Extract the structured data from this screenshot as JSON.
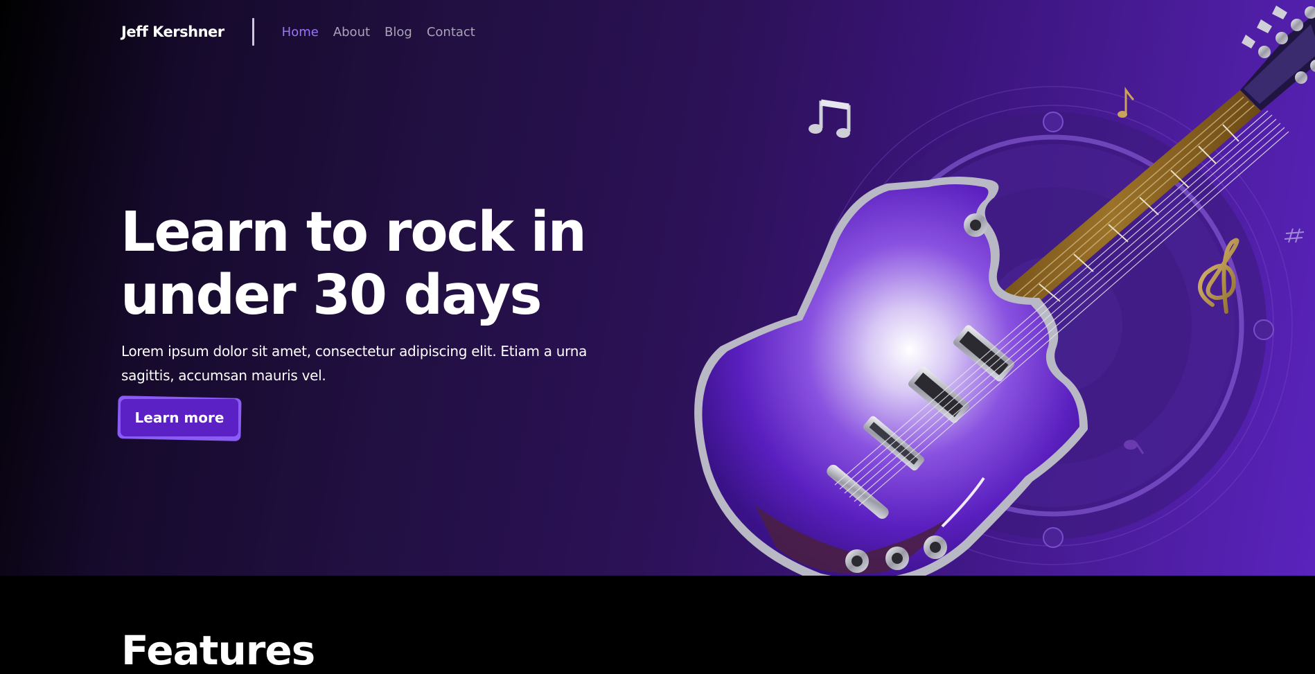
{
  "nav": {
    "logo": "Jeff Kershner",
    "links": [
      {
        "label": "Home",
        "active": true
      },
      {
        "label": "About",
        "active": false
      },
      {
        "label": "Blog",
        "active": false
      },
      {
        "label": "Contact",
        "active": false
      }
    ]
  },
  "hero": {
    "headline_line1": "Learn to rock in",
    "headline_line2": "under 30 days",
    "subtext": "Lorem ipsum dolor sit amet, consectetur adipiscing elit. Etiam a urna sagittis, accumsan mauris vel.",
    "cta_label": "Learn more",
    "illustration": "guitar-illustration"
  },
  "features": {
    "title": "Features"
  },
  "colors": {
    "accent": "#9a74ff",
    "button": "#5b21c4",
    "button_border": "#8a5cf5",
    "hero_end": "#5a23bd"
  }
}
